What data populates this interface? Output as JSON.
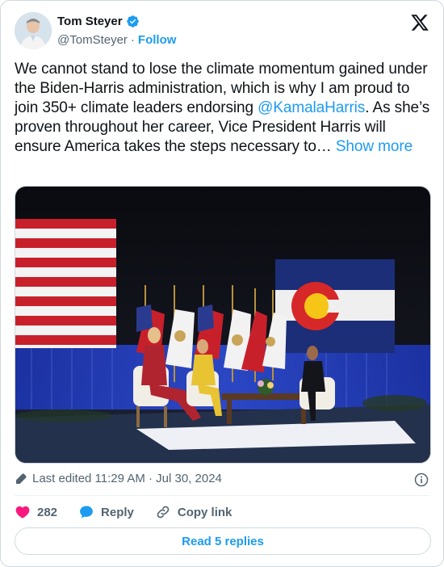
{
  "author": {
    "name": "Tom Steyer",
    "handle": "@TomSteyer",
    "separator": "·",
    "follow_label": "Follow"
  },
  "tweet": {
    "text_part1": "We cannot stand to lose the climate momentum gained under the Biden-Harris administration, which is why I am proud to join 350+ climate leaders endorsing ",
    "mention": "@KamalaHarris",
    "text_part2": ". As she’s proven throughout her career, Vice President Harris will ensure America takes the steps necessary to… ",
    "show_more": "Show more"
  },
  "meta": {
    "edited_label": "Last edited 11:29 AM · Jul 30, 2024"
  },
  "actions": {
    "like_count": "282",
    "reply_label": "Reply",
    "copy_link_label": "Copy link"
  },
  "read_replies_label": "Read 5 replies",
  "colors": {
    "accent": "#1d9bf0",
    "like": "#f91880",
    "text": "#0f1419",
    "secondary": "#536471"
  },
  "icons": [
    "verified-badge-icon",
    "x-logo-icon",
    "pencil-icon",
    "info-icon",
    "heart-icon",
    "reply-bubble-icon",
    "link-icon"
  ]
}
